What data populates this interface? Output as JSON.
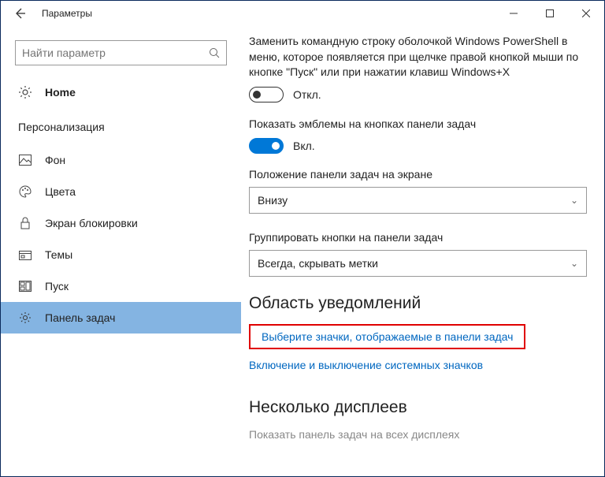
{
  "window": {
    "title": "Параметры"
  },
  "sidebar": {
    "search_placeholder": "Найти параметр",
    "home": "Home",
    "category": "Персонализация",
    "items": [
      {
        "label": "Фон"
      },
      {
        "label": "Цвета"
      },
      {
        "label": "Экран блокировки"
      },
      {
        "label": "Темы"
      },
      {
        "label": "Пуск"
      },
      {
        "label": "Панель задач"
      }
    ]
  },
  "main": {
    "desc1": "Заменить командную строку оболочкой Windows PowerShell в меню, которое появляется при щелчке правой кнопкой мыши по кнопке \"Пуск\" или при нажатии клавиш Windows+X",
    "off": "Откл.",
    "desc2": "Показать эмблемы на кнопках панели задач",
    "on": "Вкл.",
    "pos_label": "Положение панели задач на экране",
    "pos_value": "Внизу",
    "grp_label": "Группировать кнопки на панели задач",
    "grp_value": "Всегда, скрывать метки",
    "section_notif": "Область уведомлений",
    "link1": "Выберите значки, отображаемые в панели задач",
    "link2": "Включение и выключение системных значков",
    "section_displays": "Несколько дисплеев",
    "faded": "Показать панель задач на всех дисплеях"
  }
}
